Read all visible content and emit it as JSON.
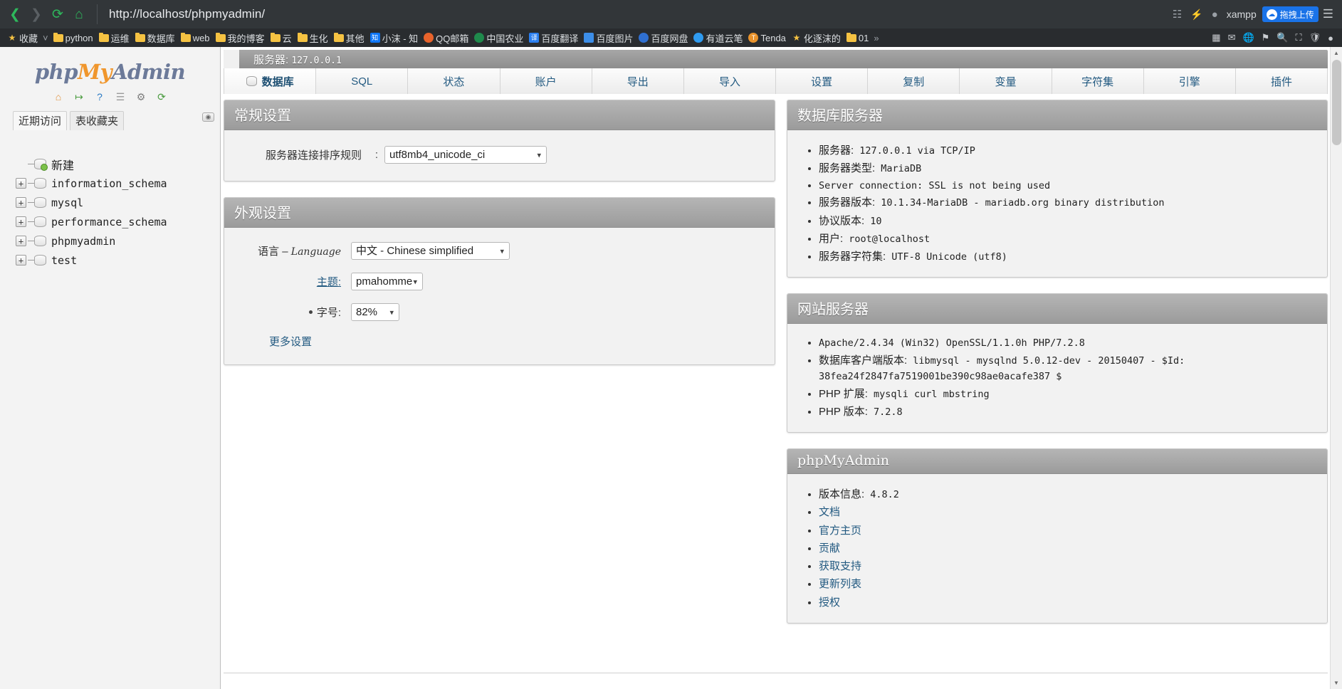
{
  "browser": {
    "back_icon": "back-arrow-icon",
    "forward_icon": "forward-arrow-icon",
    "reload_icon": "reload-icon",
    "home_icon": "home-icon",
    "url": "http://localhost/phpmyadmin/",
    "xampp_label": "xampp",
    "profile_label": "拖拽上传",
    "right_icons": [
      "extensions-icon",
      "lightning-icon",
      "user-icon"
    ],
    "menu_icon": "hamburger-menu-icon"
  },
  "bookmarks": {
    "items": [
      {
        "label": "收藏",
        "icon": "star-icon",
        "type": "star"
      },
      {
        "label": "python",
        "icon": "folder-icon",
        "type": "folder"
      },
      {
        "label": "运维",
        "icon": "folder-icon",
        "type": "folder"
      },
      {
        "label": "数据库",
        "icon": "folder-icon",
        "type": "folder"
      },
      {
        "label": "web",
        "icon": "folder-icon",
        "type": "folder"
      },
      {
        "label": "我的博客",
        "icon": "folder-icon",
        "type": "folder"
      },
      {
        "label": "云",
        "icon": "folder-icon",
        "type": "folder"
      },
      {
        "label": "生化",
        "icon": "folder-icon",
        "type": "folder"
      },
      {
        "label": "其他",
        "icon": "folder-icon",
        "type": "folder"
      },
      {
        "label": "小沫 - 知",
        "icon": "zhihu-icon",
        "type": "square",
        "glyph": "知",
        "color": "#0f76f6"
      },
      {
        "label": "QQ邮箱",
        "icon": "qqmail-icon",
        "type": "circle",
        "glyph": "",
        "color": "#e8632b"
      },
      {
        "label": "中国农业",
        "icon": "agriculture-icon",
        "type": "circle",
        "glyph": "",
        "color": "#1f8a4c"
      },
      {
        "label": "百度翻译",
        "icon": "fanyi-icon",
        "type": "square",
        "glyph": "译",
        "color": "#2a7ff0"
      },
      {
        "label": "百度图片",
        "icon": "baidu-image-icon",
        "type": "square",
        "glyph": "",
        "color": "#3c8ee8"
      },
      {
        "label": "百度网盘",
        "icon": "baidu-pan-icon",
        "type": "circle",
        "glyph": "",
        "color": "#2f6fd0"
      },
      {
        "label": "有道云笔",
        "icon": "youdao-icon",
        "type": "circle",
        "glyph": "",
        "color": "#2f9bf0"
      },
      {
        "label": "Tenda",
        "icon": "tenda-icon",
        "type": "circle",
        "glyph": "T",
        "color": "#e8922b"
      },
      {
        "label": "化逐沫的",
        "icon": "star-icon",
        "type": "star"
      },
      {
        "label": "01",
        "icon": "folder-icon",
        "type": "folder"
      }
    ],
    "overflow_icon": "chevron-double-right-icon",
    "separator_icon": "chevron-down-icon"
  },
  "sidebar": {
    "logo": {
      "part1": "php",
      "part2": "My",
      "part3": "Admin"
    },
    "quick_icons": [
      {
        "name": "home-icon",
        "glyph": "⌂",
        "color": "#e0913d"
      },
      {
        "name": "logout-icon",
        "glyph": "↦",
        "color": "#4a9b3f"
      },
      {
        "name": "help-icon",
        "glyph": "?",
        "color": "#2a7ac4"
      },
      {
        "name": "docs-icon",
        "glyph": "☰",
        "color": "#9a9a9a"
      },
      {
        "name": "settings-gear-icon",
        "glyph": "⚙",
        "color": "#7d7d7d"
      },
      {
        "name": "refresh-icon",
        "glyph": "⟳",
        "color": "#4a9b3f"
      }
    ],
    "tabs": [
      {
        "label": "近期访问",
        "active": true
      },
      {
        "label": "表收藏夹",
        "active": false
      }
    ],
    "tree_toggle_icon": "collapse-tree-icon",
    "tree": [
      {
        "label": "新建",
        "expandable": false,
        "new": true,
        "cjk": true
      },
      {
        "label": "information_schema",
        "expandable": true,
        "new": false,
        "cjk": false
      },
      {
        "label": "mysql",
        "expandable": true,
        "new": false,
        "cjk": false
      },
      {
        "label": "performance_schema",
        "expandable": true,
        "new": false,
        "cjk": false
      },
      {
        "label": "phpmyadmin",
        "expandable": true,
        "new": false,
        "cjk": false
      },
      {
        "label": "test",
        "expandable": true,
        "new": false,
        "cjk": false
      }
    ]
  },
  "main": {
    "server_bar": {
      "prefix": "服务器:",
      "ip": "127.0.0.1"
    },
    "tabs": [
      {
        "label": "数据库",
        "active": true,
        "icon": "database-icon"
      },
      {
        "label": "SQL",
        "active": false
      },
      {
        "label": "状态",
        "active": false
      },
      {
        "label": "账户",
        "active": false
      },
      {
        "label": "导出",
        "active": false
      },
      {
        "label": "导入",
        "active": false
      },
      {
        "label": "设置",
        "active": false
      },
      {
        "label": "复制",
        "active": false
      },
      {
        "label": "变量",
        "active": false
      },
      {
        "label": "字符集",
        "active": false
      },
      {
        "label": "引擎",
        "active": false
      },
      {
        "label": "插件",
        "active": false
      }
    ],
    "general_settings": {
      "title": "常规设置",
      "collation_label": "服务器连接排序规则",
      "collation_colon": ":",
      "collation_value": "utf8mb4_unicode_ci"
    },
    "appearance_settings": {
      "title": "外观设置",
      "language_label_cn": "语言",
      "language_label_dash": "–",
      "language_label_en": "Language",
      "language_value": "中文 - Chinese simplified",
      "theme_label": "主题:",
      "theme_value": "pmahomme",
      "fontsize_label": "字号:",
      "fontsize_value": "82%",
      "more_settings": "更多设置"
    },
    "database_server": {
      "title": "数据库服务器",
      "items": [
        {
          "cjk": "服务器:",
          "mono": " 127.0.0.1 via TCP/IP"
        },
        {
          "cjk": "服务器类型:",
          "mono": " MariaDB"
        },
        {
          "cjk": "",
          "mono": "Server connection: SSL is not being used"
        },
        {
          "cjk": "服务器版本:",
          "mono": " 10.1.34-MariaDB - mariadb.org binary distribution"
        },
        {
          "cjk": "协议版本:",
          "mono": " 10"
        },
        {
          "cjk": "用户:",
          "mono": " root@localhost"
        },
        {
          "cjk": "服务器字符集:",
          "mono": " UTF-8 Unicode (utf8)"
        }
      ]
    },
    "web_server": {
      "title": "网站服务器",
      "items": [
        {
          "cjk": "",
          "mono": "Apache/2.4.34 (Win32) OpenSSL/1.1.0h PHP/7.2.8"
        },
        {
          "cjk": "数据库客户端版本:",
          "mono": " libmysql - mysqlnd 5.0.12-dev - 20150407 - $Id: 38fea24f2847fa7519001be390c98ae0acafe387 $"
        },
        {
          "cjk": "PHP 扩展:",
          "mono": " mysqli curl mbstring"
        },
        {
          "cjk": "PHP 版本:",
          "mono": " 7.2.8"
        }
      ]
    },
    "phpmyadmin_panel": {
      "title": "phpMyAdmin",
      "items": [
        {
          "cjk": "版本信息:",
          "mono": " 4.8.2",
          "link": false
        },
        {
          "cjk": "文档",
          "mono": "",
          "link": true
        },
        {
          "cjk": "官方主页",
          "mono": "",
          "link": true
        },
        {
          "cjk": "贡献",
          "mono": "",
          "link": true
        },
        {
          "cjk": "获取支持",
          "mono": "",
          "link": true
        },
        {
          "cjk": "更新列表",
          "mono": "",
          "link": true
        },
        {
          "cjk": "授权",
          "mono": "",
          "link": true
        }
      ]
    }
  }
}
